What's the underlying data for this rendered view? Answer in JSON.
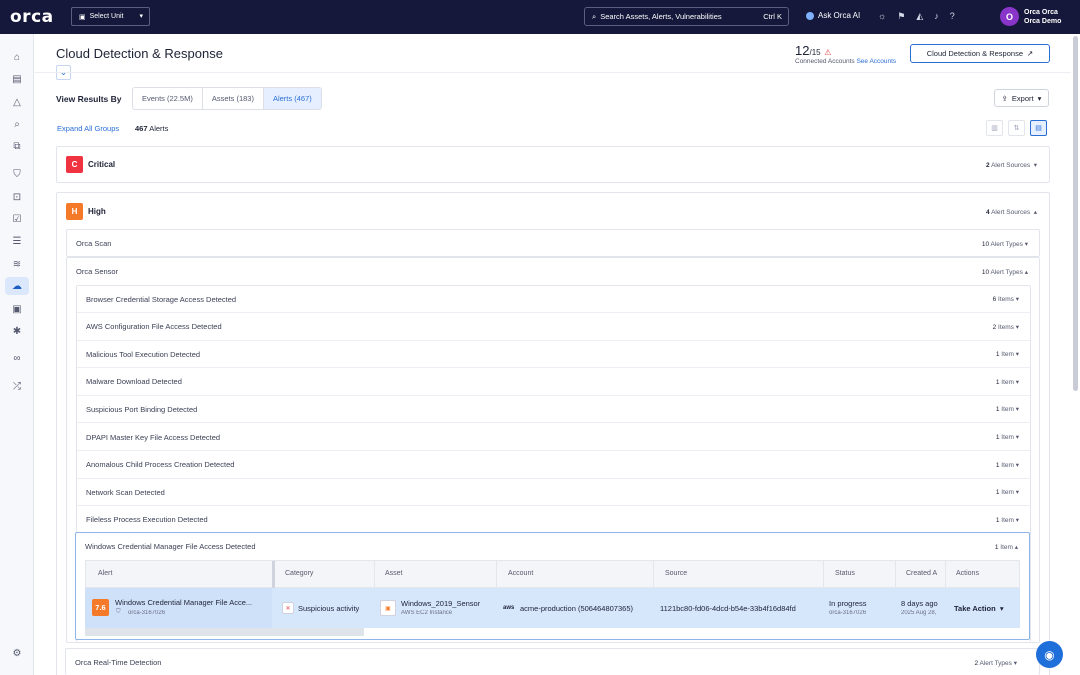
{
  "topbar": {
    "logo": "orca",
    "select_unit": "Select Unit",
    "search_placeholder": "Search Assets, Alerts, Vulnerabilities",
    "search_shortcut": "Ctrl K",
    "ask_ai": "Ask Orca AI",
    "user_initial": "O",
    "user_name": "Orca Orca",
    "user_org": "Orca Demo"
  },
  "page": {
    "title": "Cloud Detection & Response",
    "accounts_connected": "12",
    "accounts_total": "/15",
    "accounts_label": "Connected Accounts",
    "see_accounts": "See Accounts",
    "cdr_button": "Cloud Detection & Response"
  },
  "view": {
    "label": "View Results By",
    "tabs": [
      "Events (22.5M)",
      "Assets (183)",
      "Alerts (467)"
    ],
    "active_tab": 2,
    "export": "Export",
    "expand_all": "Expand All Groups",
    "alert_count_num": "467",
    "alert_count_label": "Alerts"
  },
  "groups": {
    "critical": {
      "badge": "C",
      "label": "Critical",
      "meta_num": "2",
      "meta_label": "Alert Sources"
    },
    "high": {
      "badge": "H",
      "label": "High",
      "meta_num": "4",
      "meta_label": "Alert Sources"
    }
  },
  "sources": [
    {
      "label": "Orca Scan",
      "meta_num": "10",
      "meta_label": "Alert Types"
    },
    {
      "label": "Orca Sensor",
      "meta_num": "10",
      "meta_label": "Alert Types"
    },
    {
      "label": "Orca Real-Time Detection",
      "meta_num": "2",
      "meta_label": "Alert Types"
    }
  ],
  "alert_types": [
    {
      "label": "Browser Credential Storage Access Detected",
      "meta_num": "6",
      "meta_label": "Items"
    },
    {
      "label": "AWS Configuration File Access Detected",
      "meta_num": "2",
      "meta_label": "Items"
    },
    {
      "label": "Malicious Tool Execution Detected",
      "meta_num": "1",
      "meta_label": "Item"
    },
    {
      "label": "Malware Download Detected",
      "meta_num": "1",
      "meta_label": "Item"
    },
    {
      "label": "Suspicious Port Binding Detected",
      "meta_num": "1",
      "meta_label": "Item"
    },
    {
      "label": "DPAPI Master Key File Access Detected",
      "meta_num": "1",
      "meta_label": "Item"
    },
    {
      "label": "Anomalous Child Process Creation Detected",
      "meta_num": "1",
      "meta_label": "Item"
    },
    {
      "label": "Network Scan Detected",
      "meta_num": "1",
      "meta_label": "Item"
    },
    {
      "label": "Fileless Process Execution Detected",
      "meta_num": "1",
      "meta_label": "Item"
    },
    {
      "label": "Windows Credential Manager File Access Detected",
      "meta_num": "1",
      "meta_label": "Item"
    }
  ],
  "table": {
    "headers": [
      "Alert",
      "Category",
      "Asset",
      "Account",
      "Source",
      "Status",
      "Created A",
      "Actions"
    ],
    "row": {
      "score": "7.6",
      "alert": "Windows Credential Manager File Acce...",
      "alert_id": "orca-3167026",
      "category": "Suspicious activity",
      "asset": "Windows_2019_Sensor",
      "asset_type": "AWS EC2 Instance",
      "account_logo": "aws",
      "account": "acme-production (506464807365)",
      "source": "1121bc80-fd06-4dcd-b54e-33b4f16d84fd",
      "status": "In progress",
      "status_id": "orca-3167026",
      "created": "8 days ago",
      "created_date": "2025 Aug 28,",
      "action": "Take Action"
    }
  }
}
